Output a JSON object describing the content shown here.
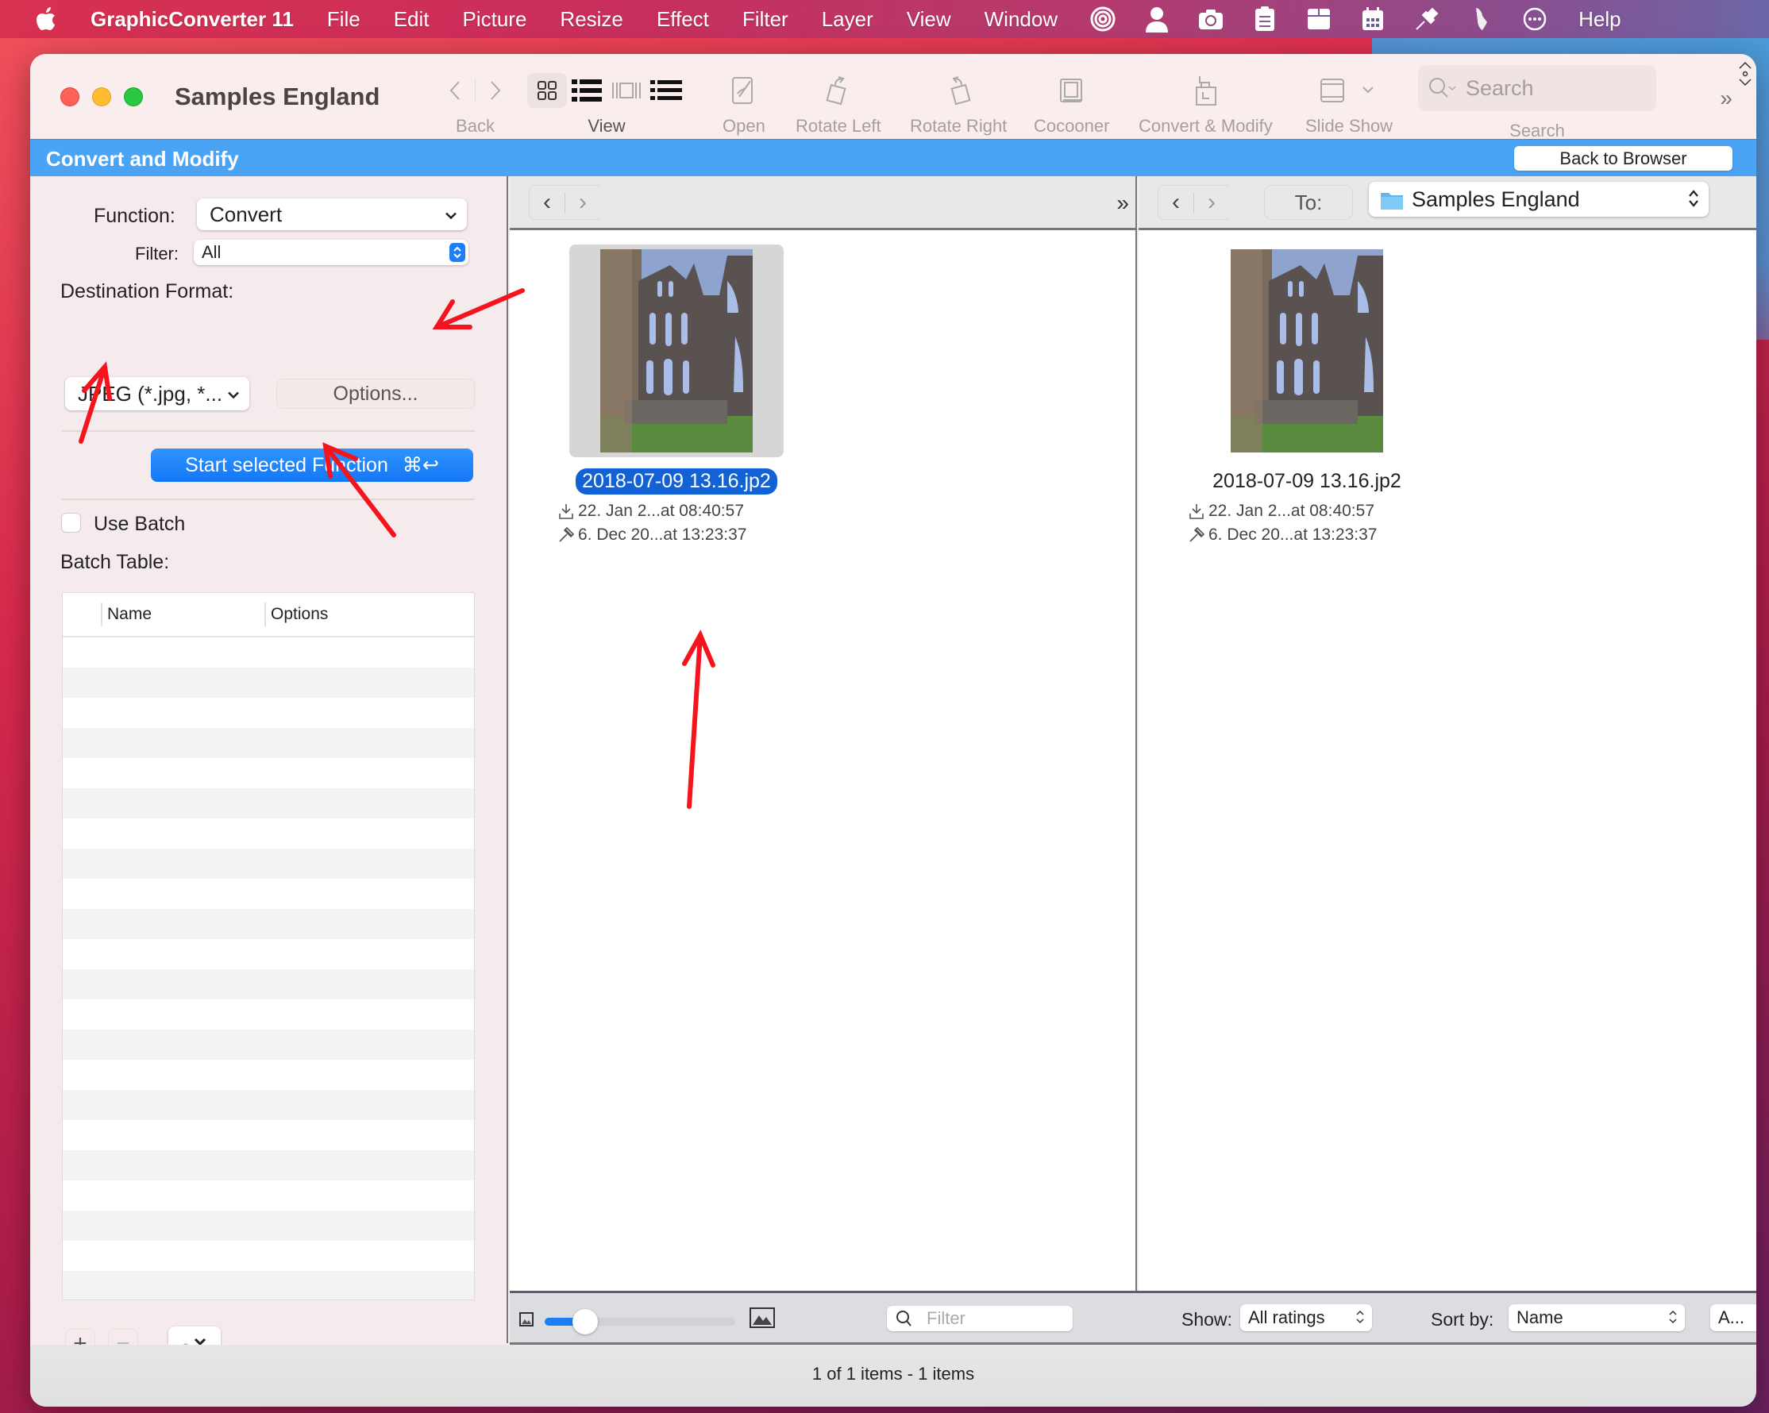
{
  "menubar": {
    "app_name": "GraphicConverter 11",
    "items": [
      "File",
      "Edit",
      "Picture",
      "Resize",
      "Effect",
      "Filter",
      "Layer",
      "View",
      "Window"
    ],
    "help": "Help",
    "status_icons": [
      "target-icon",
      "person-icon",
      "camera-icon",
      "clipboard-icon",
      "box-icon",
      "calendar-icon",
      "pin-icon",
      "scroll-icon",
      "more-icon"
    ]
  },
  "window": {
    "title": "Samples England",
    "toolbar": {
      "back_label": "Back",
      "view_label": "View",
      "open_label": "Open",
      "rotate_left_label": "Rotate Left",
      "rotate_right_label": "Rotate Right",
      "cocooner_label": "Cocooner",
      "convert_modify_label": "Convert & Modify",
      "slide_show_label": "Slide Show",
      "search_placeholder": "Search",
      "search_label": "Search",
      "overflow": "»"
    },
    "header": {
      "title": "Convert and Modify",
      "back_to_browser": "Back to Browser"
    }
  },
  "left_panel": {
    "function_label": "Function:",
    "function_value": "Convert",
    "filter_label": "Filter:",
    "filter_value": "All",
    "destination_label": "Destination Format:",
    "destination_value": "JPEG (*.jpg, *...",
    "options_button": "Options...",
    "start_button": "Start selected Function",
    "start_shortcut": "⌘↩",
    "use_batch_label": "Use Batch",
    "use_batch_checked": false,
    "batch_table_label": "Batch Table:",
    "batch_columns": [
      "Name",
      "Options"
    ],
    "batch_rows": [],
    "add_button": "+",
    "remove_button": "−"
  },
  "source_pane": {
    "items": [
      {
        "name": "2018-07-09 13.16.jp2",
        "selected": true,
        "added": "22. Jan 2...at 08:40:57",
        "modified": "6. Dec 20...at 13:23:37"
      }
    ]
  },
  "dest_pane": {
    "to_label": "To:",
    "folder": "Samples England",
    "items": [
      {
        "name": "2018-07-09 13.16.jp2",
        "selected": false,
        "added": "22. Jan 2...at 08:40:57",
        "modified": "6. Dec 20...at 13:23:37"
      }
    ]
  },
  "bottom_bar": {
    "thumbnail_size_fraction": 0.18,
    "filter_placeholder": "Filter",
    "show_label": "Show:",
    "show_value": "All ratings",
    "sort_label": "Sort by:",
    "sort_value": "Name",
    "order_value": "A..."
  },
  "status": {
    "text": "1 of 1 items - 1 items"
  },
  "colors": {
    "accent_blue": "#4aa3f5",
    "selection_blue": "#1262d6",
    "button_blue": "#1477f6",
    "annotation_red": "#f5141e"
  }
}
